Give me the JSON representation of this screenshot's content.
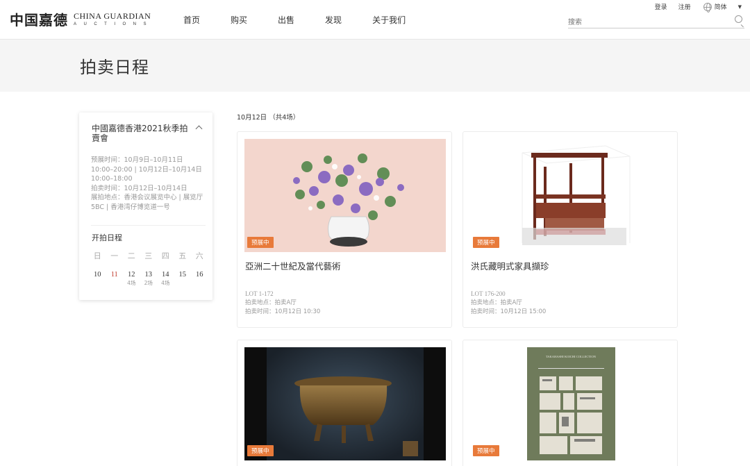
{
  "header": {
    "logo_cn": "中国嘉德",
    "logo_en_top": "CHINA GUARDIAN",
    "logo_en_bottom": "AUCTIONS",
    "nav": [
      "首页",
      "购买",
      "出售",
      "发现",
      "关于我们"
    ],
    "login": "登录",
    "register": "注册",
    "language": "简体",
    "search_placeholder": "搜索"
  },
  "page_title": "拍卖日程",
  "sidebar": {
    "title": "中國嘉德香港2021秋季拍賣會",
    "preview_time": "预展时间：10月9日–10月11日 10:00–20:00 | 10月12日–10月14日 10:00–18:00",
    "auction_time": "拍卖时间：10月12日–10月14日",
    "venue": "展拍地点：香港会议展览中心 | 展览厅5BC | 香港湾仔博览道一号",
    "schedule_title": "开拍日程",
    "weekdays": [
      "日",
      "一",
      "二",
      "三",
      "四",
      "五",
      "六"
    ],
    "days": [
      {
        "day": "10",
        "count": ""
      },
      {
        "day": "11",
        "count": ""
      },
      {
        "day": "12",
        "count": "4场"
      },
      {
        "day": "13",
        "count": "2场"
      },
      {
        "day": "14",
        "count": "4场"
      },
      {
        "day": "15",
        "count": ""
      },
      {
        "day": "16",
        "count": ""
      }
    ]
  },
  "date_heading": "10月12日 （共4场）",
  "cards": [
    {
      "badge": "预展中",
      "title": "亞洲二十世紀及當代藝術",
      "lot": "LOT 1-172",
      "venue": "拍卖地点：拍卖A厅",
      "time": "拍卖时间：10月12日 10:30"
    },
    {
      "badge": "预展中",
      "title": "洪氏藏明式家具擷珍",
      "lot": "LOT 176-200",
      "venue": "拍卖地点：拍卖A厅",
      "time": "拍卖时间：10月12日 15:00"
    },
    {
      "badge": "预展中",
      "title": "",
      "lot": "",
      "venue": "",
      "time": ""
    },
    {
      "badge": "预展中",
      "title": "",
      "lot": "",
      "venue": "",
      "time": "",
      "cover_text": "TAKAHASHI KOICHI COLLECTION"
    }
  ],
  "colors": {
    "accent": "#e87a3a",
    "today": "#c0392b"
  }
}
